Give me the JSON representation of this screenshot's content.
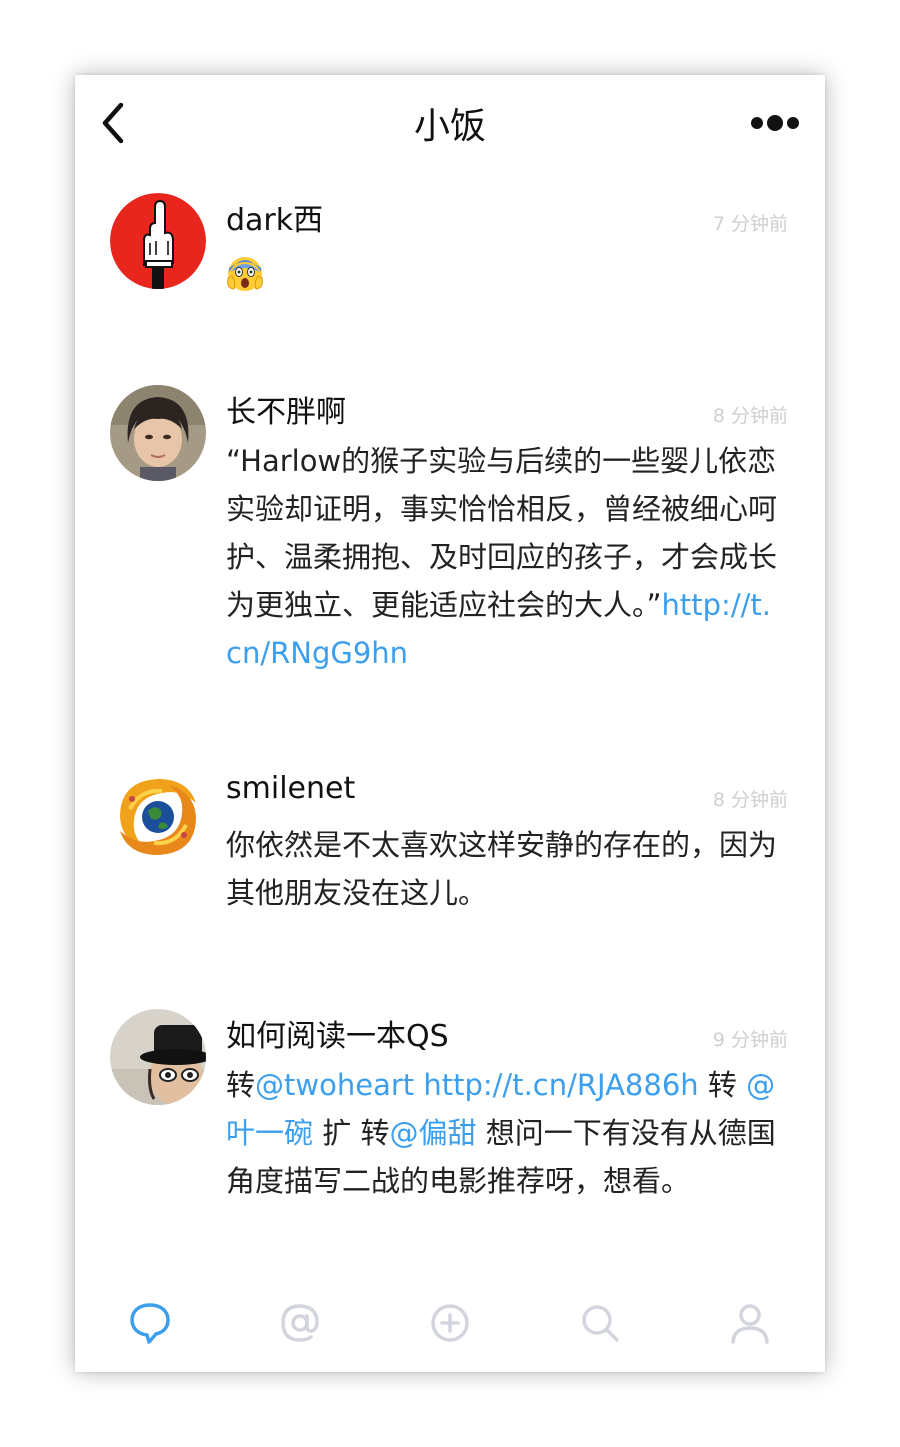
{
  "header": {
    "title": "小饭",
    "back_icon": "chevron-left-icon",
    "more_icon": "more-dots-icon"
  },
  "colors": {
    "accent": "#3c9fee",
    "text": "#222222",
    "timestamp": "#cfcfd4",
    "tab_inactive": "#d2d5dd"
  },
  "posts": [
    {
      "author": "dark西",
      "time": "7 分钟前",
      "avatar": "middle-finger-glove-avatar",
      "emoji": "screaming-face-emoji"
    },
    {
      "author": "长不胖啊",
      "time": "8 分钟前",
      "avatar": "portrait-photo-avatar",
      "text": "“Harlow的猴子实验与后续的一些婴儿依恋实验却证明，事实恰恰相反，曾经被细心呵护、温柔拥抱、及时回应的孩子，才会成长为更独立、更能适应社会的大人。”",
      "link": "http://t.cn/RNgG9hn"
    },
    {
      "author": "smilenet",
      "time": "8 分钟前",
      "avatar": "globe-dragon-avatar",
      "text": "你依然是不太喜欢这样安静的存在的，因为其他朋友没在这儿。"
    },
    {
      "author": "如何阅读一本QS",
      "time": "9 分钟前",
      "avatar": "hat-man-avatar",
      "parts": {
        "p1": "转",
        "mention1": "@twoheart",
        "link1": "http://t.cn/RJA886h",
        "p2": "转",
        "mention2": "@叶一碗",
        "p3": "扩 转",
        "mention3": "@偏甜",
        "p4": "想问一下有没有从德国角度描写二战的电影推荐呀，想看。"
      }
    }
  ],
  "tabbar": {
    "tabs": [
      {
        "icon": "chat-bubble-icon",
        "active": true
      },
      {
        "icon": "at-sign-icon",
        "active": false
      },
      {
        "icon": "plus-circle-icon",
        "active": false
      },
      {
        "icon": "search-icon",
        "active": false
      },
      {
        "icon": "profile-icon",
        "active": false
      }
    ]
  }
}
